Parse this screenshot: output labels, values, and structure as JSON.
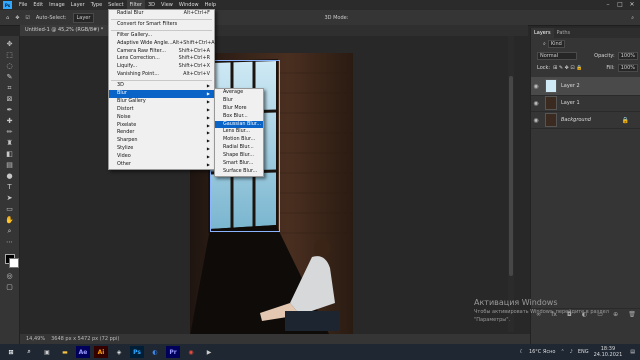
{
  "menubar": {
    "logo": "Ps",
    "items": [
      "File",
      "Edit",
      "Image",
      "Layer",
      "Type",
      "Select",
      "Filter",
      "3D",
      "View",
      "Window",
      "Help"
    ],
    "active": "Filter"
  },
  "options": {
    "auto_select": "Auto-Select:",
    "auto_select_value": "Layer",
    "mode_3d": "3D Mode:"
  },
  "document": {
    "tab_title": "Untitled-1 @ 45,2% (RGB/8#) *",
    "zoom": "14,49%",
    "doc_size": "3648 px x 5472 px (72 ppi)"
  },
  "filter_menu": {
    "items": [
      {
        "label": "Radial Blur",
        "shortcut": "Alt+Ctrl+F"
      },
      {
        "sep": true
      },
      {
        "label": "Convert for Smart Filters",
        "shortcut": ""
      },
      {
        "sep": true
      },
      {
        "label": "Filter Gallery...",
        "shortcut": ""
      },
      {
        "label": "Adaptive Wide Angle...",
        "shortcut": "Alt+Shift+Ctrl+A"
      },
      {
        "label": "Camera Raw Filter...",
        "shortcut": "Shift+Ctrl+A"
      },
      {
        "label": "Lens Correction...",
        "shortcut": "Shift+Ctrl+R"
      },
      {
        "label": "Liquify...",
        "shortcut": "Shift+Ctrl+X"
      },
      {
        "label": "Vanishing Point...",
        "shortcut": "Alt+Ctrl+V"
      },
      {
        "sep": true
      },
      {
        "label": "3D",
        "submenu": true
      },
      {
        "label": "Blur",
        "submenu": true,
        "highlight": true
      },
      {
        "label": "Blur Gallery",
        "submenu": true
      },
      {
        "label": "Distort",
        "submenu": true
      },
      {
        "label": "Noise",
        "submenu": true
      },
      {
        "label": "Pixelate",
        "submenu": true
      },
      {
        "label": "Render",
        "submenu": true
      },
      {
        "label": "Sharpen",
        "submenu": true
      },
      {
        "label": "Stylize",
        "submenu": true
      },
      {
        "label": "Video",
        "submenu": true
      },
      {
        "label": "Other",
        "submenu": true
      }
    ]
  },
  "blur_submenu": {
    "items": [
      {
        "label": "Average"
      },
      {
        "label": "Blur"
      },
      {
        "label": "Blur More"
      },
      {
        "label": "Box Blur..."
      },
      {
        "label": "Gaussian Blur...",
        "highlight": true
      },
      {
        "label": "Lens Blur..."
      },
      {
        "label": "Motion Blur..."
      },
      {
        "label": "Radial Blur..."
      },
      {
        "label": "Shape Blur..."
      },
      {
        "label": "Smart Blur..."
      },
      {
        "label": "Surface Blur..."
      }
    ]
  },
  "layers_panel": {
    "tabs": [
      "Layers",
      "Paths"
    ],
    "kind": "Kind",
    "blend_mode": "Normal",
    "opacity_label": "Opacity:",
    "opacity": "100%",
    "lock_label": "Lock:",
    "fill_label": "Fill:",
    "fill": "100%",
    "layers": [
      {
        "name": "Layer 2",
        "selected": true
      },
      {
        "name": "Layer 1",
        "selected": false
      },
      {
        "name": "Background",
        "selected": false
      }
    ]
  },
  "watermark": {
    "line1": "Активация Windows",
    "line2": "Чтобы активировать Windows, перейдите в раздел",
    "line3": "\"Параметры\"."
  },
  "taskbar": {
    "weather": "16°C Ясно",
    "lang": "ENG",
    "time": "18:39",
    "date": "24.10.2021",
    "apps": [
      "Ae",
      "Ai",
      "Ps",
      "Pr"
    ]
  },
  "colors": {
    "accent_highlight": "#0a64c8",
    "ps_blue": "#31a8ff"
  }
}
